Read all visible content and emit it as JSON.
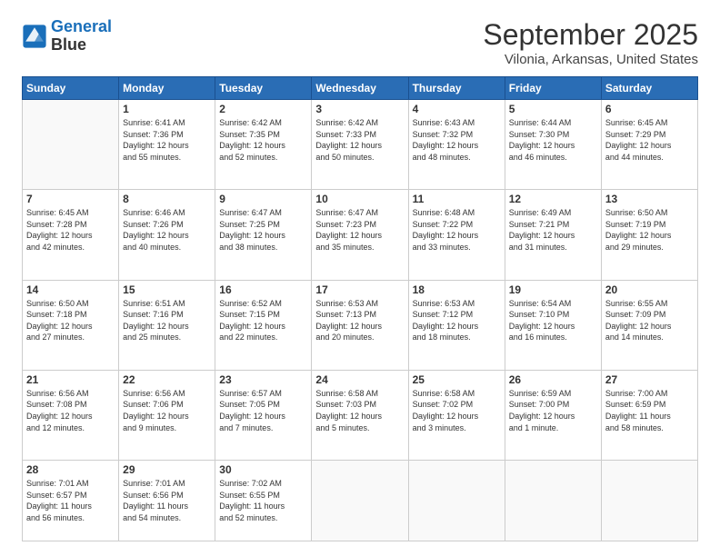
{
  "header": {
    "logo_line1": "General",
    "logo_line2": "Blue",
    "main_title": "September 2025",
    "subtitle": "Vilonia, Arkansas, United States"
  },
  "columns": [
    "Sunday",
    "Monday",
    "Tuesday",
    "Wednesday",
    "Thursday",
    "Friday",
    "Saturday"
  ],
  "weeks": [
    [
      {
        "num": "",
        "info": ""
      },
      {
        "num": "1",
        "info": "Sunrise: 6:41 AM\nSunset: 7:36 PM\nDaylight: 12 hours\nand 55 minutes."
      },
      {
        "num": "2",
        "info": "Sunrise: 6:42 AM\nSunset: 7:35 PM\nDaylight: 12 hours\nand 52 minutes."
      },
      {
        "num": "3",
        "info": "Sunrise: 6:42 AM\nSunset: 7:33 PM\nDaylight: 12 hours\nand 50 minutes."
      },
      {
        "num": "4",
        "info": "Sunrise: 6:43 AM\nSunset: 7:32 PM\nDaylight: 12 hours\nand 48 minutes."
      },
      {
        "num": "5",
        "info": "Sunrise: 6:44 AM\nSunset: 7:30 PM\nDaylight: 12 hours\nand 46 minutes."
      },
      {
        "num": "6",
        "info": "Sunrise: 6:45 AM\nSunset: 7:29 PM\nDaylight: 12 hours\nand 44 minutes."
      }
    ],
    [
      {
        "num": "7",
        "info": "Sunrise: 6:45 AM\nSunset: 7:28 PM\nDaylight: 12 hours\nand 42 minutes."
      },
      {
        "num": "8",
        "info": "Sunrise: 6:46 AM\nSunset: 7:26 PM\nDaylight: 12 hours\nand 40 minutes."
      },
      {
        "num": "9",
        "info": "Sunrise: 6:47 AM\nSunset: 7:25 PM\nDaylight: 12 hours\nand 38 minutes."
      },
      {
        "num": "10",
        "info": "Sunrise: 6:47 AM\nSunset: 7:23 PM\nDaylight: 12 hours\nand 35 minutes."
      },
      {
        "num": "11",
        "info": "Sunrise: 6:48 AM\nSunset: 7:22 PM\nDaylight: 12 hours\nand 33 minutes."
      },
      {
        "num": "12",
        "info": "Sunrise: 6:49 AM\nSunset: 7:21 PM\nDaylight: 12 hours\nand 31 minutes."
      },
      {
        "num": "13",
        "info": "Sunrise: 6:50 AM\nSunset: 7:19 PM\nDaylight: 12 hours\nand 29 minutes."
      }
    ],
    [
      {
        "num": "14",
        "info": "Sunrise: 6:50 AM\nSunset: 7:18 PM\nDaylight: 12 hours\nand 27 minutes."
      },
      {
        "num": "15",
        "info": "Sunrise: 6:51 AM\nSunset: 7:16 PM\nDaylight: 12 hours\nand 25 minutes."
      },
      {
        "num": "16",
        "info": "Sunrise: 6:52 AM\nSunset: 7:15 PM\nDaylight: 12 hours\nand 22 minutes."
      },
      {
        "num": "17",
        "info": "Sunrise: 6:53 AM\nSunset: 7:13 PM\nDaylight: 12 hours\nand 20 minutes."
      },
      {
        "num": "18",
        "info": "Sunrise: 6:53 AM\nSunset: 7:12 PM\nDaylight: 12 hours\nand 18 minutes."
      },
      {
        "num": "19",
        "info": "Sunrise: 6:54 AM\nSunset: 7:10 PM\nDaylight: 12 hours\nand 16 minutes."
      },
      {
        "num": "20",
        "info": "Sunrise: 6:55 AM\nSunset: 7:09 PM\nDaylight: 12 hours\nand 14 minutes."
      }
    ],
    [
      {
        "num": "21",
        "info": "Sunrise: 6:56 AM\nSunset: 7:08 PM\nDaylight: 12 hours\nand 12 minutes."
      },
      {
        "num": "22",
        "info": "Sunrise: 6:56 AM\nSunset: 7:06 PM\nDaylight: 12 hours\nand 9 minutes."
      },
      {
        "num": "23",
        "info": "Sunrise: 6:57 AM\nSunset: 7:05 PM\nDaylight: 12 hours\nand 7 minutes."
      },
      {
        "num": "24",
        "info": "Sunrise: 6:58 AM\nSunset: 7:03 PM\nDaylight: 12 hours\nand 5 minutes."
      },
      {
        "num": "25",
        "info": "Sunrise: 6:58 AM\nSunset: 7:02 PM\nDaylight: 12 hours\nand 3 minutes."
      },
      {
        "num": "26",
        "info": "Sunrise: 6:59 AM\nSunset: 7:00 PM\nDaylight: 12 hours\nand 1 minute."
      },
      {
        "num": "27",
        "info": "Sunrise: 7:00 AM\nSunset: 6:59 PM\nDaylight: 11 hours\nand 58 minutes."
      }
    ],
    [
      {
        "num": "28",
        "info": "Sunrise: 7:01 AM\nSunset: 6:57 PM\nDaylight: 11 hours\nand 56 minutes."
      },
      {
        "num": "29",
        "info": "Sunrise: 7:01 AM\nSunset: 6:56 PM\nDaylight: 11 hours\nand 54 minutes."
      },
      {
        "num": "30",
        "info": "Sunrise: 7:02 AM\nSunset: 6:55 PM\nDaylight: 11 hours\nand 52 minutes."
      },
      {
        "num": "",
        "info": ""
      },
      {
        "num": "",
        "info": ""
      },
      {
        "num": "",
        "info": ""
      },
      {
        "num": "",
        "info": ""
      }
    ]
  ]
}
